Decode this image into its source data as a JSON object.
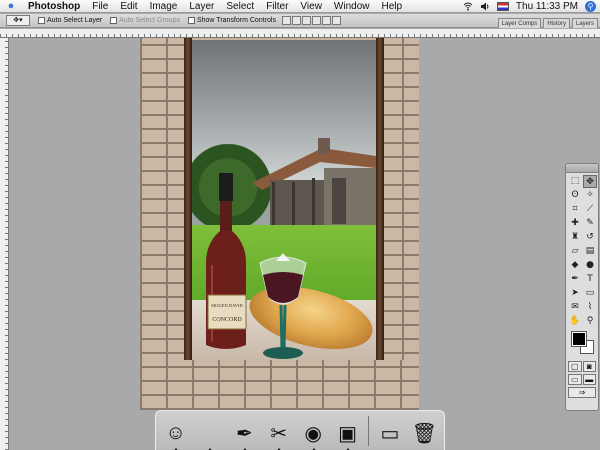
{
  "menubar": {
    "apple_icon": "apple-icon",
    "app_name": "Photoshop",
    "menus": [
      "File",
      "Edit",
      "Image",
      "Layer",
      "Select",
      "Filter",
      "View",
      "Window",
      "Help"
    ],
    "status_icons": [
      "wifi-icon",
      "volume-icon",
      "input-flag-icon"
    ],
    "clock": "Thu 11:33 PM",
    "spotlight_icon": "spotlight-icon"
  },
  "options_bar": {
    "tool_icon": "move-tool-icon",
    "auto_select_layer": "Auto Select Layer",
    "auto_select_groups": "Auto Select Groups",
    "show_transform_controls": "Show Transform Controls",
    "palette_tabs": [
      "Layer Comps",
      "History",
      "Layers"
    ]
  },
  "tools": {
    "items": [
      {
        "name": "marquee-tool",
        "glyph": "⬚"
      },
      {
        "name": "move-tool",
        "glyph": "✥"
      },
      {
        "name": "lasso-tool",
        "glyph": "ʘ"
      },
      {
        "name": "magic-wand-tool",
        "glyph": "✧"
      },
      {
        "name": "crop-tool",
        "glyph": "⌗"
      },
      {
        "name": "slice-tool",
        "glyph": "⟋"
      },
      {
        "name": "healing-brush-tool",
        "glyph": "✚"
      },
      {
        "name": "brush-tool",
        "glyph": "✎"
      },
      {
        "name": "clone-stamp-tool",
        "glyph": "♜"
      },
      {
        "name": "history-brush-tool",
        "glyph": "↺"
      },
      {
        "name": "eraser-tool",
        "glyph": "▱"
      },
      {
        "name": "gradient-tool",
        "glyph": "▤"
      },
      {
        "name": "blur-tool",
        "glyph": "◆"
      },
      {
        "name": "dodge-tool",
        "glyph": "●"
      },
      {
        "name": "pen-tool",
        "glyph": "✒"
      },
      {
        "name": "type-tool",
        "glyph": "T"
      },
      {
        "name": "path-selection-tool",
        "glyph": "➤"
      },
      {
        "name": "shape-tool",
        "glyph": "▭"
      },
      {
        "name": "notes-tool",
        "glyph": "✉"
      },
      {
        "name": "eyedropper-tool",
        "glyph": "⌇"
      },
      {
        "name": "hand-tool",
        "glyph": "✋"
      },
      {
        "name": "zoom-tool",
        "glyph": "⚲"
      }
    ],
    "foreground_color": "#000000",
    "background_color": "#ffffff"
  },
  "dock": {
    "items": [
      {
        "name": "finder-icon",
        "glyph": "☺",
        "running": true
      },
      {
        "name": "system-preferences-icon",
        "glyph": "",
        "running": true
      },
      {
        "name": "quill-app-icon",
        "glyph": "✒",
        "running": true
      },
      {
        "name": "scissors-app-icon",
        "glyph": "✂",
        "running": true
      },
      {
        "name": "firefox-icon",
        "glyph": "◉",
        "running": true
      },
      {
        "name": "photoshop-icon",
        "glyph": "▣",
        "running": true
      },
      {
        "name": "documents-folder-icon",
        "glyph": "▭",
        "running": false
      },
      {
        "name": "trash-icon",
        "glyph": "🗑",
        "running": false
      }
    ]
  },
  "canvas": {
    "wine_label": "CONCORD",
    "wine_brand": "MOGEN DAVID"
  }
}
